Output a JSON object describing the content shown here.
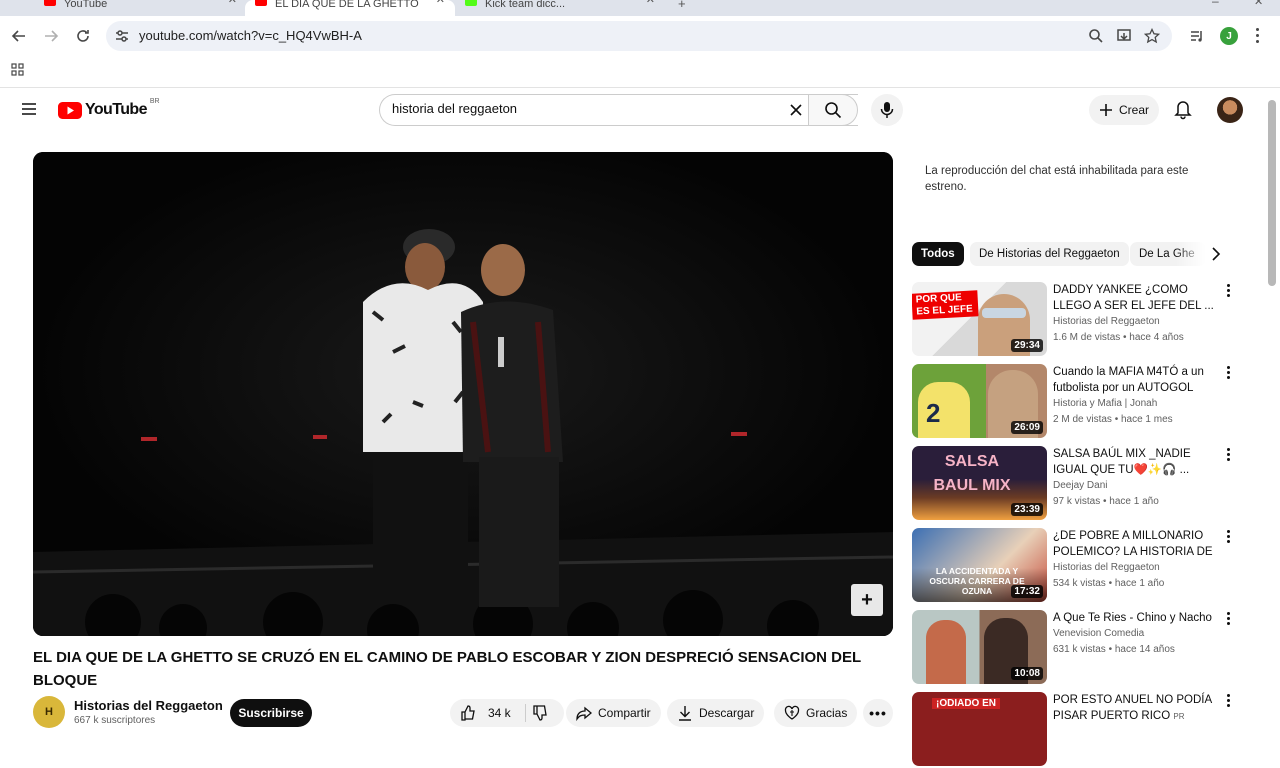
{
  "browser": {
    "tabs": [
      {
        "label": "YouTube",
        "color": "#ff0000"
      },
      {
        "label": "EL DIA QUE DE LA GHETTO",
        "color": "#ff0000"
      },
      {
        "label": "Kick team dicc...",
        "color": "#53fc18"
      }
    ],
    "url": "youtube.com/watch?v=c_HQ4VwBH-A",
    "profile_initial": "J"
  },
  "header": {
    "logo_text": "YouTube",
    "country": "BR",
    "search_value": "historia del reggaeton",
    "create_label": "Crear"
  },
  "video": {
    "title": "EL DIA QUE DE LA GHETTO SE CRUZÓ EN EL CAMINO DE PABLO ESCOBAR Y ZION DESPRECIÓ SENSACION DEL BLOQUE",
    "channel": "Historias del Reggaeton",
    "subs": "667 k suscriptores",
    "subscribe_label": "Suscribirse",
    "likes": "34 k",
    "share_label": "Compartir",
    "download_label": "Descargar",
    "thanks_label": "Gracias"
  },
  "chat": {
    "message": "La reproducción del chat está inhabilitada para este estreno."
  },
  "chips": [
    "Todos",
    "De Historias del Reggaeton",
    "De La Ghe"
  ],
  "recommendations": [
    {
      "title": "DADDY YANKEE ¿COMO LLEGO A SER EL JEFE DEL ...",
      "channel": "Historias del Reggaeton",
      "meta": "1.6 M de vistas • hace 4 años",
      "duration": "29:34",
      "thumb_text": "POR QUE ES EL JEFE"
    },
    {
      "title": "Cuando la MAFIA M4TÓ a un futbolista por un AUTOGOL",
      "channel": "Historia y Mafia | Jonah",
      "meta": "2 M de vistas • hace 1 mes",
      "duration": "26:09",
      "thumb_text": "2"
    },
    {
      "title": "SALSA BAÚL MIX _NADIE IGUAL QUE TU❤️✨🎧 ...",
      "channel": "Deejay Dani",
      "meta": "97 k vistas • hace 1 año",
      "duration": "23:39",
      "thumb_text": "SALSA BAUL MIX"
    },
    {
      "title": "¿DE POBRE A MILLONARIO POLEMICO? LA HISTORIA DE ...",
      "channel": "Historias del Reggaeton",
      "meta": "534 k vistas • hace 1 año",
      "duration": "17:32",
      "thumb_text": "LA ACCIDENTADA Y OSCURA CARRERA DE OZUNA"
    },
    {
      "title": "A Que Te Ries - Chino y Nacho",
      "channel": "Venevision Comedia",
      "meta": "631 k vistas • hace 14 años",
      "duration": "10:08",
      "thumb_text": ""
    },
    {
      "title": "POR ESTO ANUEL NO PODÍA PISAR PUERTO RICO",
      "channel": "",
      "meta": "",
      "duration": "",
      "thumb_text": "¡ODIADO EN"
    }
  ],
  "title_pr_badge": "PR",
  "avatar_text": "H"
}
